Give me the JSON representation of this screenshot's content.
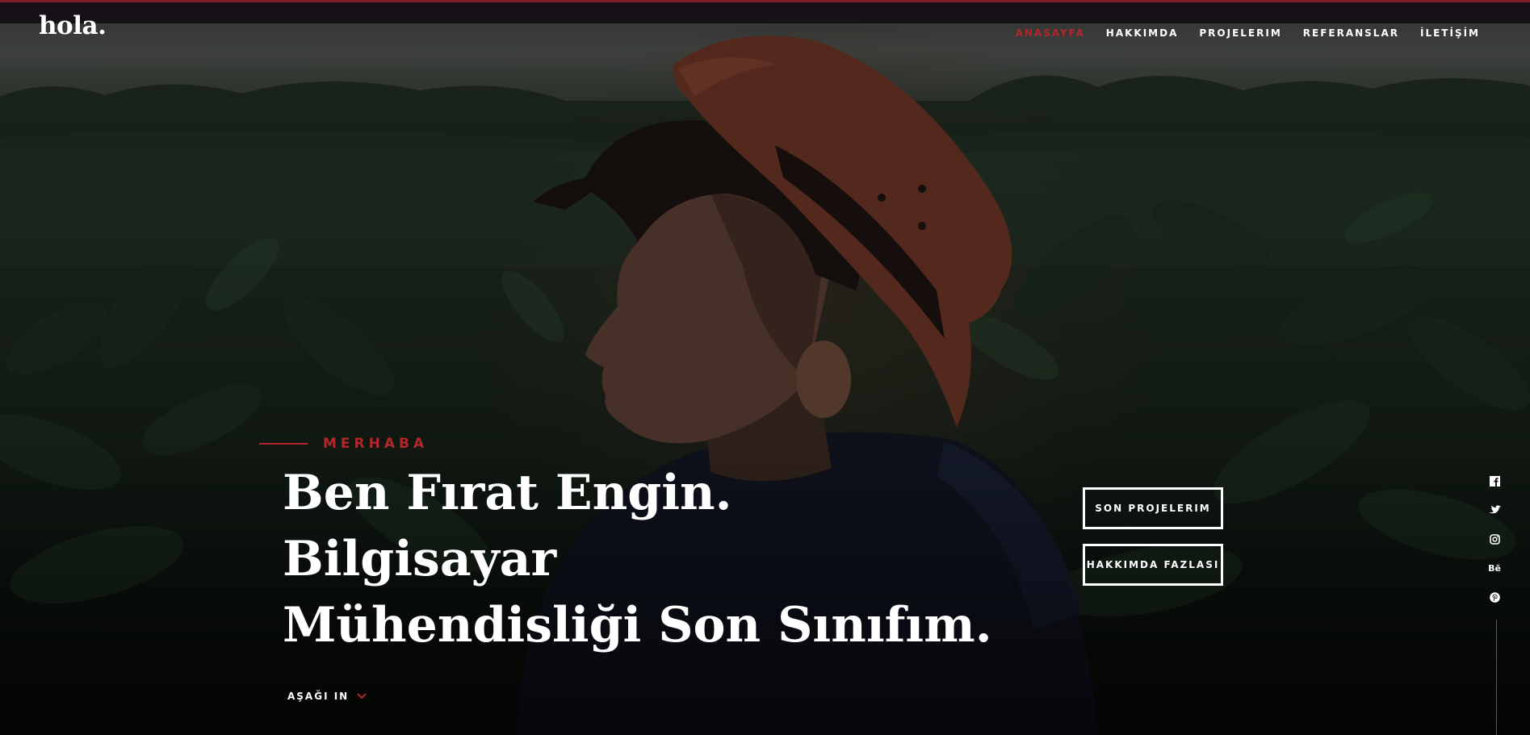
{
  "brand": {
    "logo": "hola."
  },
  "nav": {
    "items": [
      {
        "label": "ANASAYFA",
        "active": true
      },
      {
        "label": "HAKKIMDA",
        "active": false
      },
      {
        "label": "PROJELERIM",
        "active": false
      },
      {
        "label": "REFERANSLAR",
        "active": false
      },
      {
        "label": "İLETİŞİM",
        "active": false
      }
    ]
  },
  "hero": {
    "intro": "MERHABA",
    "headline_line1": "Ben Fırat Engin. Bilgisayar",
    "headline_line2": "Mühendisliği Son Sınıfım.",
    "buttons": {
      "primary": "SON PROJELERIM",
      "secondary": "HAKKIMDA FAZLASI"
    },
    "scroll_label": "AŞAĞI IN"
  },
  "social": {
    "icons": [
      "facebook-icon",
      "twitter-icon",
      "instagram-icon",
      "behance-icon",
      "pinterest-icon"
    ],
    "behance_glyph": "Bē"
  },
  "colors": {
    "accent": "#b3262c",
    "top_border": "#7f1d24",
    "text": "#ffffff"
  }
}
